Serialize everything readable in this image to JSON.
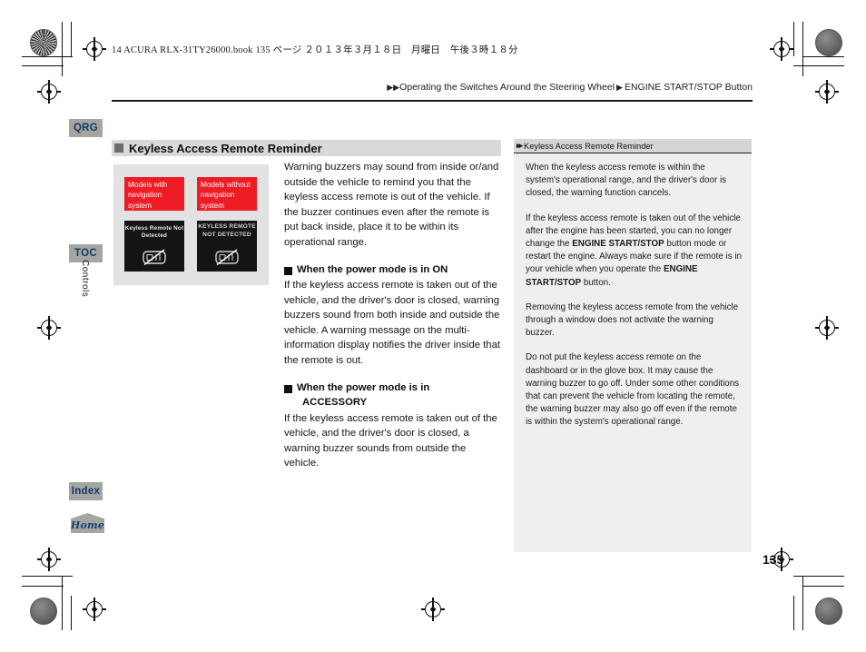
{
  "print_header": "14 ACURA RLX-31TY26000.book  135 ページ  ２０１３年３月１８日　月曜日　午後３時１８分",
  "breadcrumb": {
    "arrow1": "▶▶",
    "item1": "Operating the Switches Around the Steering Wheel",
    "arrow2": "▶",
    "item2": "ENGINE START/STOP Button"
  },
  "sidebar": {
    "tabs": [
      {
        "label": "QRG"
      },
      {
        "label": "TOC"
      },
      {
        "label": "Index"
      },
      {
        "label": "Home"
      }
    ],
    "chapter_label": "Controls"
  },
  "section": {
    "title": "Keyless Access Remote Reminder"
  },
  "figure": {
    "caption_left": "Models with navigation system",
    "caption_right": "Models without navigation system",
    "display_left_text": "Keyless Remote Not Detected",
    "display_right_text": "KEYLESS REMOTE NOT DETECTED",
    "icon_name": "key-fob-not-detected-icon",
    "red_color": "#ee1c25"
  },
  "main": {
    "intro": "Warning buzzers may sound from inside or/and outside the vehicle to remind you that the keyless access remote is out of the vehicle. If the buzzer continues even after the remote is put back inside, place it to be within its operational range.",
    "subsections": [
      {
        "heading": "When the power mode is in ON",
        "heading_line2": "",
        "text": "If the keyless access remote is taken out of the vehicle, and the driver's door is closed, warning buzzers sound from both inside and outside the vehicle. A warning message on the multi-information display notifies the driver inside that the remote is out."
      },
      {
        "heading": "When the power mode is in",
        "heading_line2": "ACCESSORY",
        "text": "If the keyless access remote is taken out of the vehicle, and the driver's door is closed, a warning buzzer sounds from outside the vehicle."
      }
    ]
  },
  "info_panel": {
    "header": "Keyless Access Remote Reminder",
    "paragraphs": [
      {
        "prefix": "When the keyless access remote is within the system's operational range, and the driver's door is closed, the warning function cancels.",
        "bold": "",
        "suffix": ""
      },
      {
        "prefix": "If the keyless access remote is taken out of the vehicle after the engine has been started, you can no longer change the ",
        "bold": "ENGINE START/STOP",
        "suffix": " button mode or restart the engine. Always make sure if the remote is in your vehicle when you operate the ",
        "bold2": "ENGINE START/STOP",
        "suffix2": " button."
      },
      {
        "prefix": "Removing the keyless access remote from the vehicle through a window does not activate the warning buzzer.",
        "bold": "",
        "suffix": ""
      },
      {
        "prefix": "Do not put the keyless access remote on the dashboard or in the glove box. It may cause the warning buzzer to go off. Under some other conditions that can prevent the vehicle from locating the remote, the warning buzzer may also go off even if the remote is within the system's operational range.",
        "bold": "",
        "suffix": ""
      }
    ]
  },
  "page_number": "135"
}
